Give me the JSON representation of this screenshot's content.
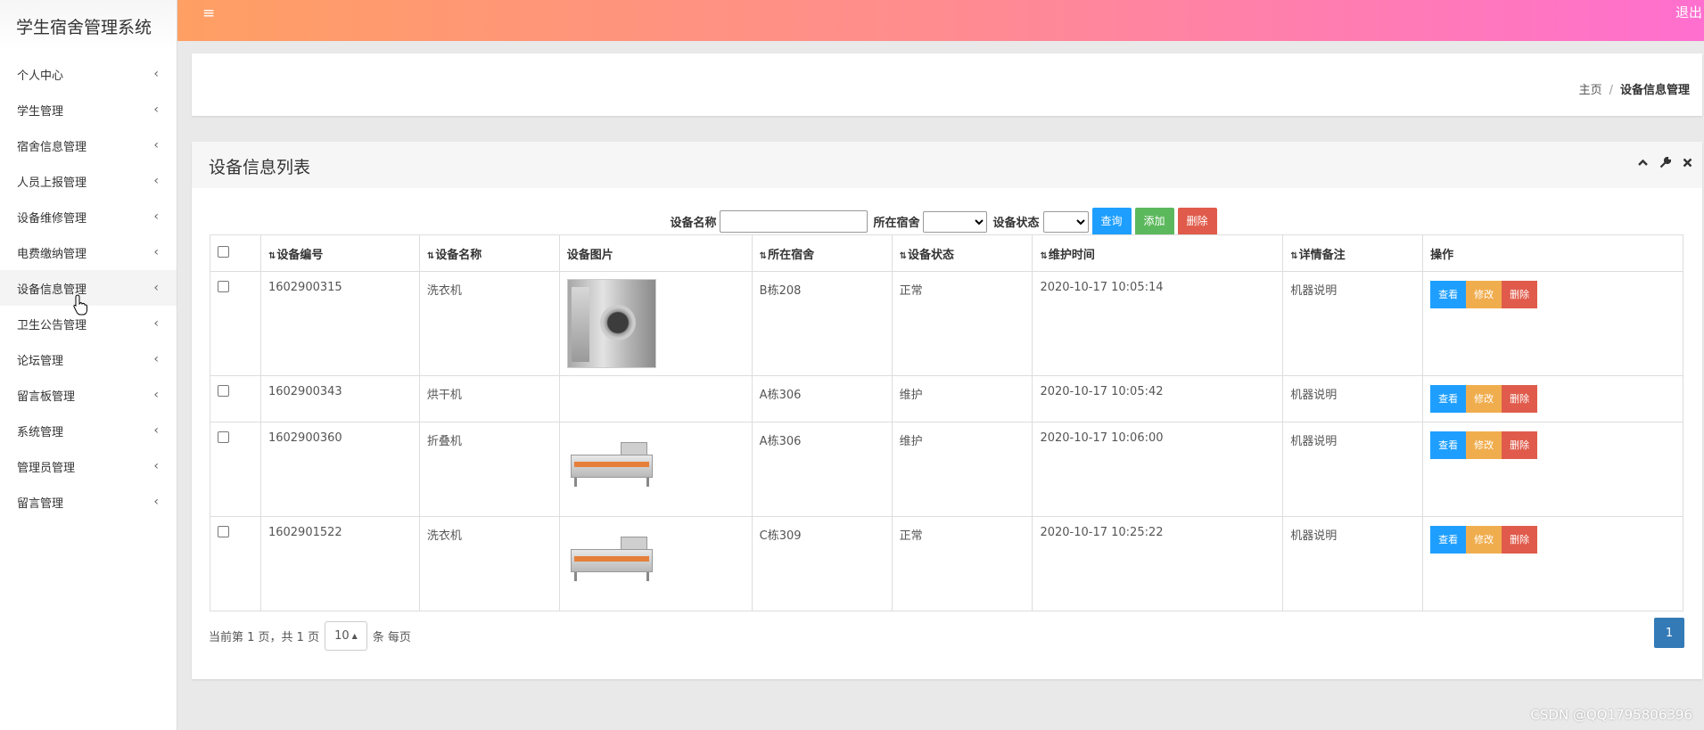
{
  "app": {
    "title": "学生宿舍管理系统",
    "logout": "退出"
  },
  "sidebar": {
    "items": [
      {
        "label": "个人中心"
      },
      {
        "label": "学生管理"
      },
      {
        "label": "宿舍信息管理"
      },
      {
        "label": "人员上报管理"
      },
      {
        "label": "设备维修管理"
      },
      {
        "label": "电费缴纳管理"
      },
      {
        "label": "设备信息管理"
      },
      {
        "label": "卫生公告管理"
      },
      {
        "label": "论坛管理"
      },
      {
        "label": "留言板管理"
      },
      {
        "label": "系统管理"
      },
      {
        "label": "管理员管理"
      },
      {
        "label": "留言管理"
      }
    ],
    "chevron": "‹"
  },
  "breadcrumb": {
    "home": "主页",
    "separator": "/",
    "current": "设备信息管理"
  },
  "panel": {
    "title": "设备信息列表"
  },
  "search": {
    "name_label": "设备名称",
    "dorm_label": "所在宿舍",
    "status_label": "设备状态",
    "query_button": "查询",
    "add_button": "添加",
    "delete_button": "删除"
  },
  "table": {
    "headers": {
      "code": "设备编号",
      "name": "设备名称",
      "image": "设备图片",
      "dorm": "所在宿舍",
      "status": "设备状态",
      "time": "维护时间",
      "remark": "详情备注",
      "ops": "操作"
    },
    "op_labels": {
      "view": "查看",
      "edit": "修改",
      "delete": "删除"
    },
    "rows": [
      {
        "code": "1602900315",
        "name": "洗衣机",
        "image": "washer-image",
        "dorm": "B栋208",
        "status": "正常",
        "time": "2020-10-17 10:05:14",
        "remark": "机器说明"
      },
      {
        "code": "1602900343",
        "name": "烘干机",
        "image": "",
        "dorm": "A栋306",
        "status": "维护",
        "time": "2020-10-17 10:05:42",
        "remark": "机器说明"
      },
      {
        "code": "1602900360",
        "name": "折叠机",
        "image": "ironer-image",
        "dorm": "A栋306",
        "status": "维护",
        "time": "2020-10-17 10:06:00",
        "remark": "机器说明"
      },
      {
        "code": "1602901522",
        "name": "洗衣机",
        "image": "ironer-image",
        "dorm": "C栋309",
        "status": "正常",
        "time": "2020-10-17 10:25:22",
        "remark": "机器说明"
      }
    ]
  },
  "pager": {
    "info": "当前第 1 页，共 1 页",
    "page_size": "10",
    "per_page_suffix": "条 每页",
    "current_page": "1"
  },
  "watermark": "CSDN @QQ1795806396",
  "colors": {
    "accent": "#1e9fff",
    "success": "#5cb85c",
    "warning": "#f0ad4e",
    "danger": "#e05b4b",
    "pager": "#337ab7"
  }
}
